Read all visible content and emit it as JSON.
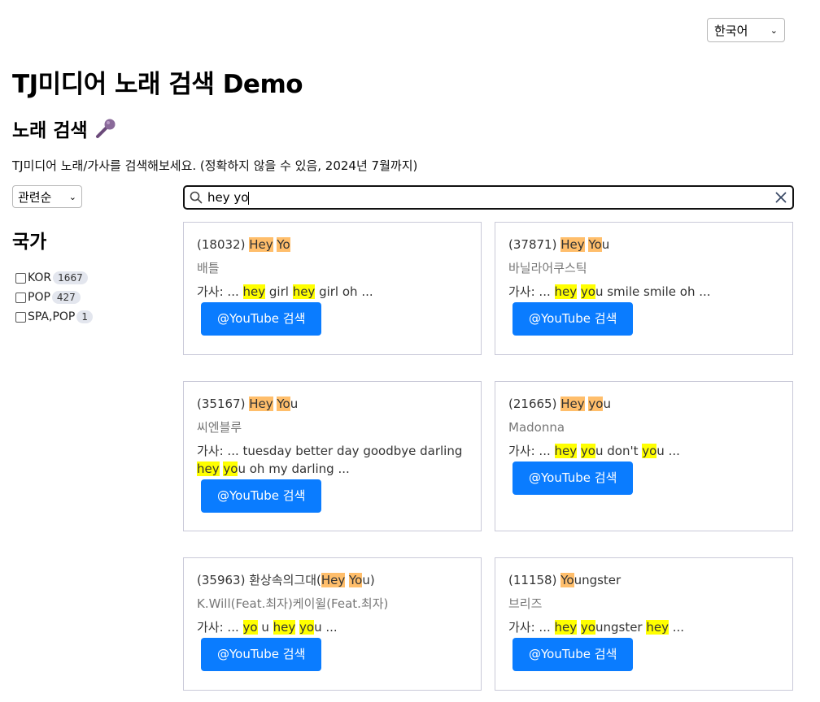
{
  "language_select": {
    "value": "한국어"
  },
  "page_title": "TJ미디어 노래 검색 Demo",
  "section_title": "노래 검색",
  "description": "TJ미디어 노래/가사를 검색해보세요. (정확하지 않을 수 있음, 2024년 7월까지)",
  "sort_select": {
    "value": "관련순"
  },
  "search": {
    "query": "hey yo"
  },
  "facet_title": "국가",
  "facets": [
    {
      "label": "KOR",
      "count": "1667"
    },
    {
      "label": "POP",
      "count": "427"
    },
    {
      "label": "SPA,POP",
      "count": "1"
    }
  ],
  "youtube_button_label": "@YouTube 검색",
  "results": [
    {
      "title": [
        [
          "(18032) ",
          ""
        ],
        [
          "Hey",
          "o"
        ],
        [
          " ",
          ""
        ],
        [
          "Yo",
          "o"
        ]
      ],
      "artist": "배틀",
      "lyrics": [
        [
          "가사: ... ",
          ""
        ],
        [
          "hey",
          "y"
        ],
        [
          " girl ",
          ""
        ],
        [
          "hey",
          "y"
        ],
        [
          " girl oh ...",
          ""
        ]
      ]
    },
    {
      "title": [
        [
          "(37871) ",
          ""
        ],
        [
          "Hey",
          "o"
        ],
        [
          " ",
          ""
        ],
        [
          "Yo",
          "o"
        ],
        [
          "u",
          ""
        ]
      ],
      "artist": "바닐라어쿠스틱",
      "lyrics": [
        [
          "가사: ... ",
          ""
        ],
        [
          "hey",
          "y"
        ],
        [
          " ",
          ""
        ],
        [
          "yo",
          "y"
        ],
        [
          "u smile smile oh ...",
          ""
        ]
      ]
    },
    {
      "title": [
        [
          "(35167) ",
          ""
        ],
        [
          "Hey",
          "o"
        ],
        [
          " ",
          ""
        ],
        [
          "Yo",
          "o"
        ],
        [
          "u",
          ""
        ]
      ],
      "artist": "씨엔블루",
      "lyrics": [
        [
          "가사: ... tuesday better day goodbye darling ",
          ""
        ],
        [
          "hey",
          "y"
        ],
        [
          " ",
          ""
        ],
        [
          "yo",
          "y"
        ],
        [
          "u oh my darling ...",
          ""
        ]
      ]
    },
    {
      "title": [
        [
          "(21665) ",
          ""
        ],
        [
          "Hey",
          "o"
        ],
        [
          " ",
          ""
        ],
        [
          "yo",
          "o"
        ],
        [
          "u",
          ""
        ]
      ],
      "artist": "Madonna",
      "lyrics": [
        [
          "가사: ... ",
          ""
        ],
        [
          "hey",
          "y"
        ],
        [
          " ",
          ""
        ],
        [
          "yo",
          "y"
        ],
        [
          "u don't ",
          ""
        ],
        [
          "yo",
          "y"
        ],
        [
          "u ...",
          ""
        ]
      ]
    },
    {
      "title": [
        [
          "(35963) 환상속의그대(",
          ""
        ],
        [
          "Hey",
          "o"
        ],
        [
          " ",
          ""
        ],
        [
          "Yo",
          "o"
        ],
        [
          "u)",
          ""
        ]
      ],
      "artist": "K.Will(Feat.최자)케이윌(Feat.최자)",
      "lyrics": [
        [
          "가사: ... ",
          ""
        ],
        [
          "yo",
          "y"
        ],
        [
          " u ",
          ""
        ],
        [
          "hey",
          "y"
        ],
        [
          " ",
          ""
        ],
        [
          "yo",
          "y"
        ],
        [
          "u ...",
          ""
        ]
      ]
    },
    {
      "title": [
        [
          "(11158) ",
          ""
        ],
        [
          "Yo",
          "o"
        ],
        [
          "ungster",
          ""
        ]
      ],
      "artist": "브리즈",
      "lyrics": [
        [
          "가사: ... ",
          ""
        ],
        [
          "hey",
          "y"
        ],
        [
          " ",
          ""
        ],
        [
          "yo",
          "y"
        ],
        [
          "ungster ",
          ""
        ],
        [
          "hey",
          "y"
        ],
        [
          " ...",
          ""
        ]
      ]
    }
  ]
}
